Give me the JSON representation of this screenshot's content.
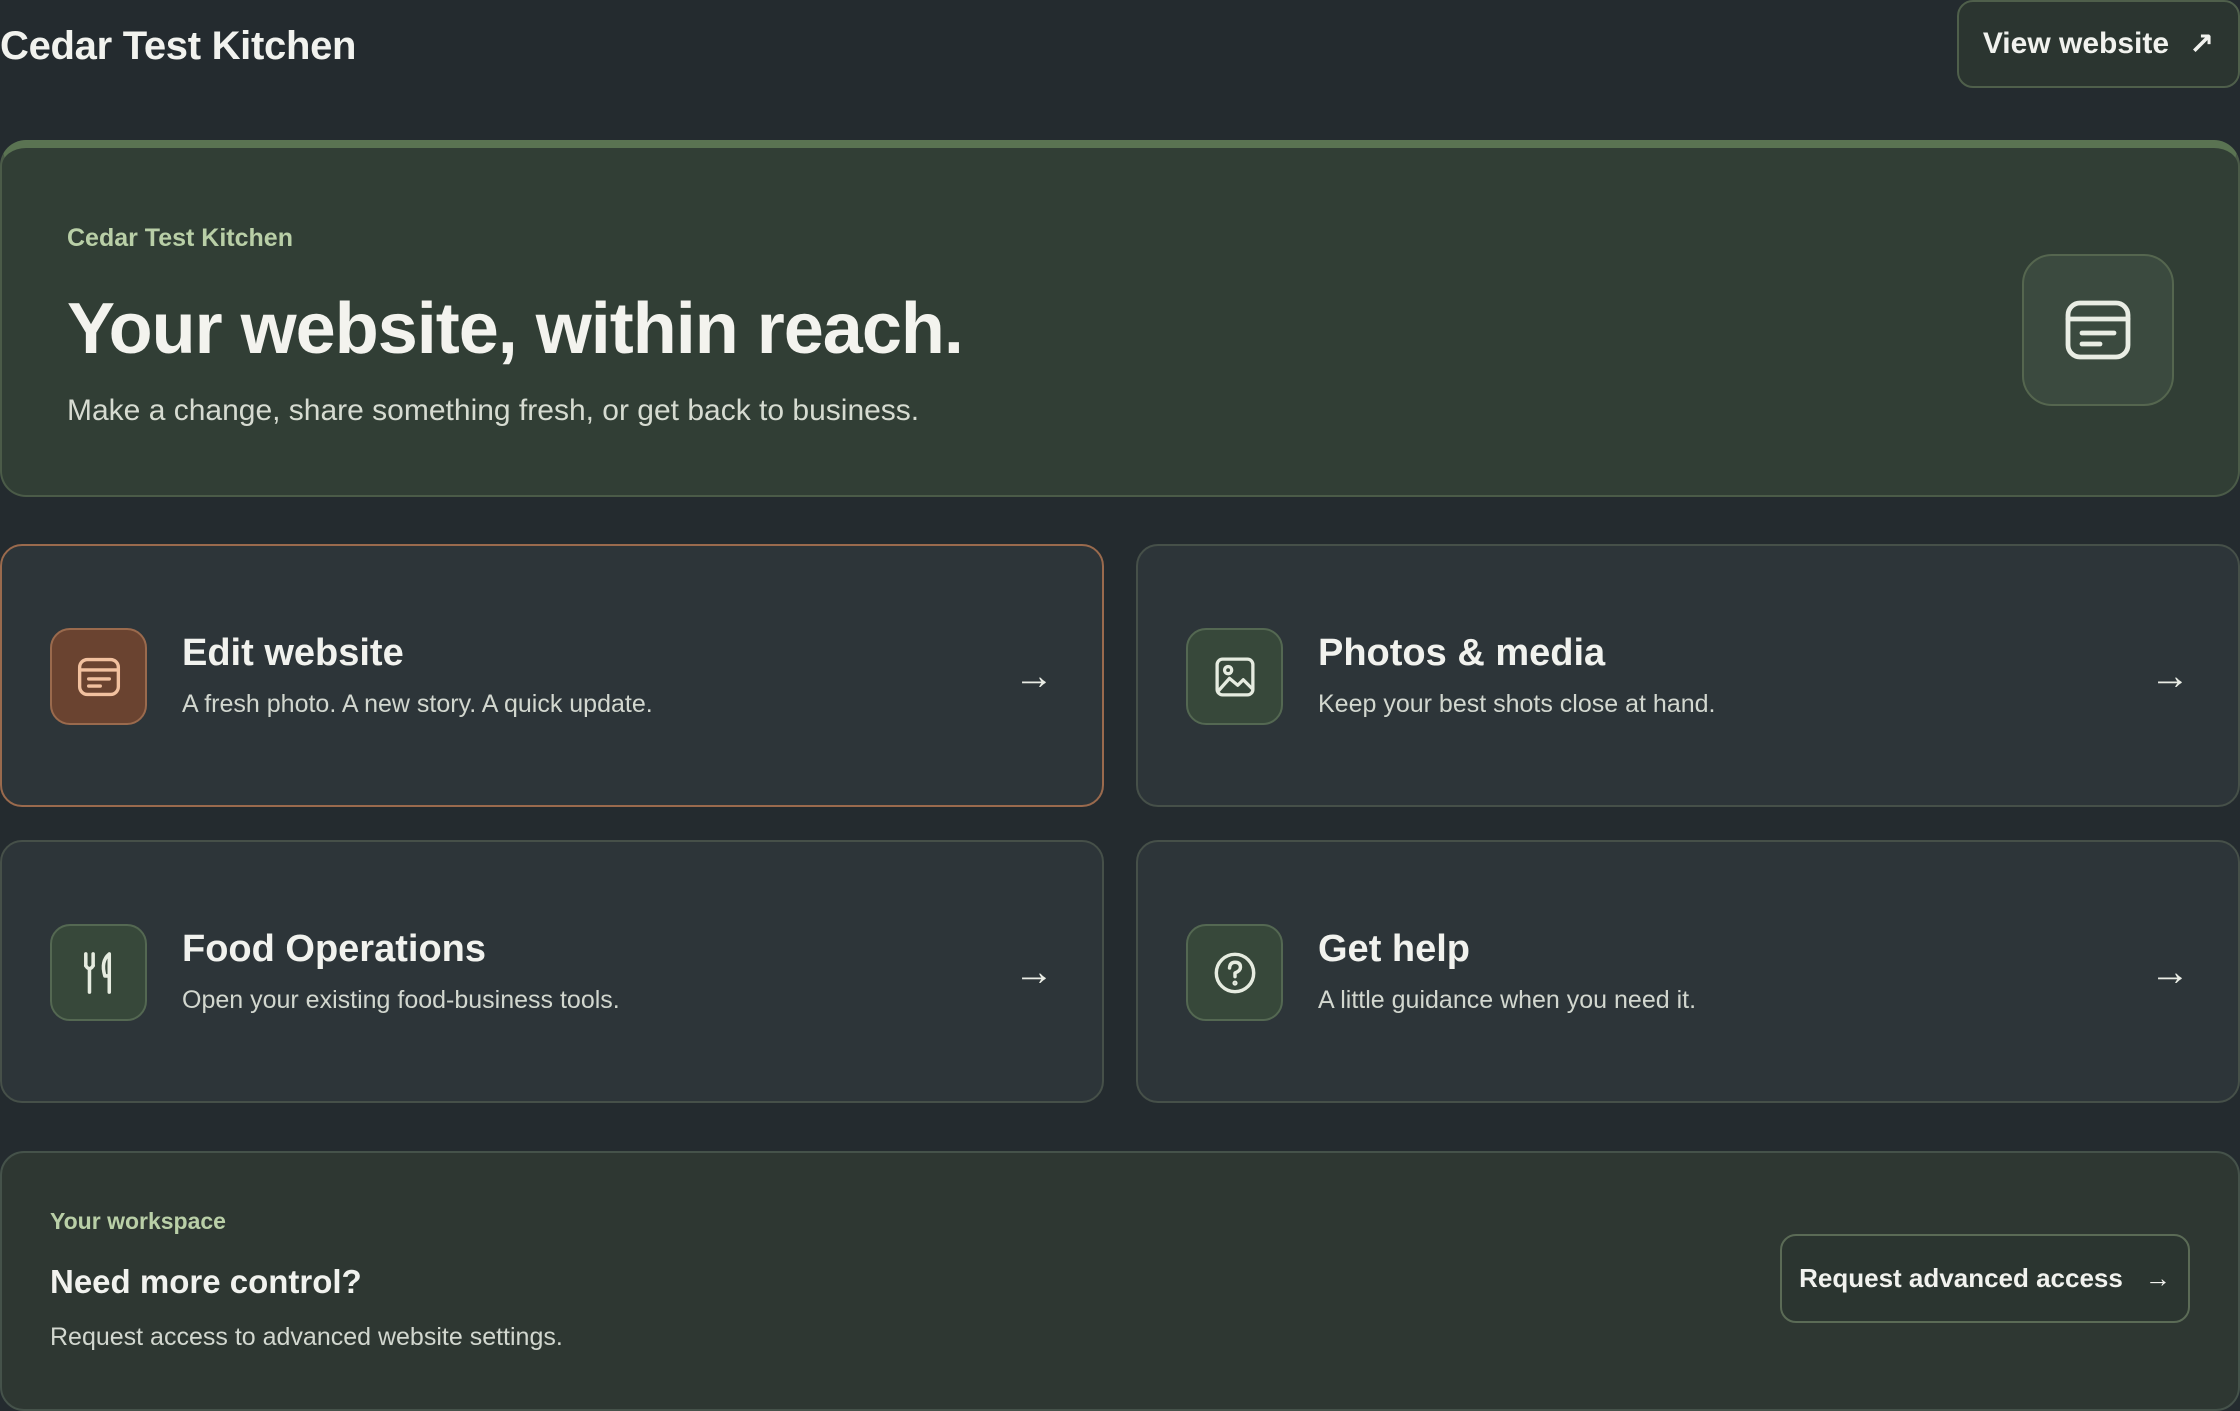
{
  "header": {
    "brand": "Cedar Test Kitchen",
    "view_website_label": "View website",
    "view_website_icon": "↗"
  },
  "hero": {
    "eyebrow": "Cedar Test Kitchen",
    "title": "Your website, within reach.",
    "subtitle": "Make a change, share something fresh, or get back to business.",
    "icon": "layout-icon"
  },
  "cards": [
    {
      "title": "Edit website",
      "desc": "A fresh photo. A new story. A quick update.",
      "icon": "edit-layout-icon",
      "arrow": "→",
      "active": true
    },
    {
      "title": "Photos & media",
      "desc": "Keep your best shots close at hand.",
      "icon": "image-icon",
      "arrow": "→",
      "active": false
    },
    {
      "title": "Food Operations",
      "desc": "Open your existing food-business tools.",
      "icon": "utensils-icon",
      "arrow": "→",
      "active": false
    },
    {
      "title": "Get help",
      "desc": "A little guidance when you need it.",
      "icon": "help-circle-icon",
      "arrow": "→",
      "active": false
    }
  ],
  "workspace": {
    "eyebrow": "Your workspace",
    "title": "Need more control?",
    "desc": "Request access to advanced website settings.",
    "button_label": "Request advanced access",
    "button_arrow": "→"
  },
  "colors": {
    "background": "#242b2f",
    "accent_green": "#b9cfa7",
    "accent_copper": "#9a6a4d"
  }
}
